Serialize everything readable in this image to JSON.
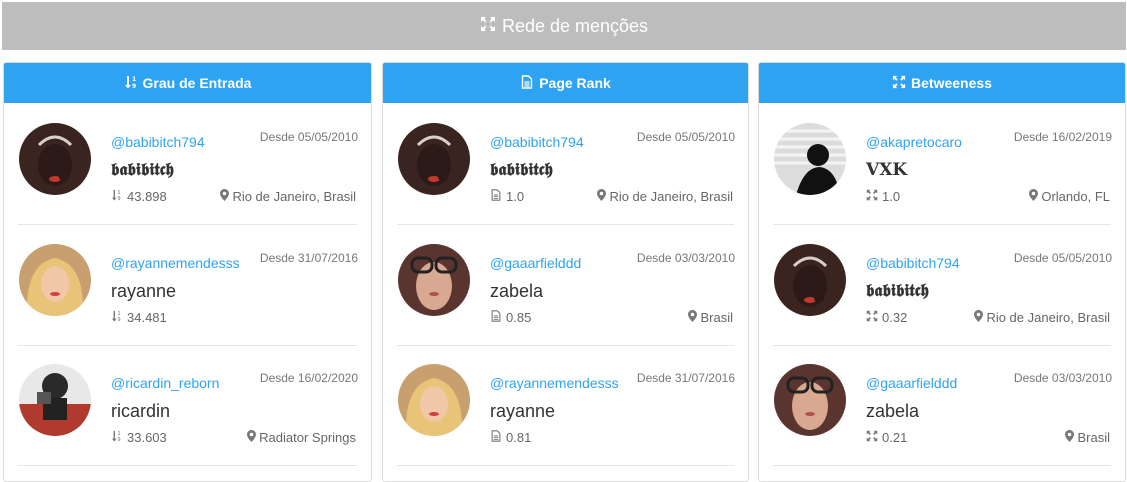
{
  "header": {
    "title": "Rede de menções",
    "icon": "expand-icon"
  },
  "panels": [
    {
      "title": "Grau de Entrada",
      "icon": "sort-numeric-icon",
      "users": [
        {
          "handle": "@babibitch794",
          "since": "Desde 05/05/2010",
          "name": "𝖇𝖆𝖇𝖎𝖇𝖎𝖙𝖈𝖍",
          "metric": "43.898",
          "location": "Rio de Janeiro, Brasil",
          "avatar": "dark"
        },
        {
          "handle": "@rayannemendesss",
          "since": "Desde 31/07/2016",
          "name": "rayanne",
          "metric": "34.481",
          "location": "",
          "avatar": "blonde"
        },
        {
          "handle": "@ricardin_reborn",
          "since": "Desde 16/02/2020",
          "name": "ricardin",
          "metric": "33.603",
          "location": "Radiator Springs",
          "avatar": "mirror"
        }
      ]
    },
    {
      "title": "Page Rank",
      "icon": "file-icon",
      "users": [
        {
          "handle": "@babibitch794",
          "since": "Desde 05/05/2010",
          "name": "𝖇𝖆𝖇𝖎𝖇𝖎𝖙𝖈𝖍",
          "metric": "1.0",
          "location": "Rio de Janeiro, Brasil",
          "avatar": "dark"
        },
        {
          "handle": "@gaaarfielddd",
          "since": "Desde 03/03/2010",
          "name": "zabela",
          "metric": "0.85",
          "location": "Brasil",
          "avatar": "glasses"
        },
        {
          "handle": "@rayannemendesss",
          "since": "Desde 31/07/2016",
          "name": "rayanne",
          "metric": "0.81",
          "location": "",
          "avatar": "blonde"
        }
      ]
    },
    {
      "title": "Betweeness",
      "icon": "expand-icon",
      "users": [
        {
          "handle": "@akapretocaro",
          "since": "Desde 16/02/2019",
          "name": "𝐕𝐗𝐊",
          "metric": "1.0",
          "location": "Orlando, FL",
          "avatar": "silhouette"
        },
        {
          "handle": "@babibitch794",
          "since": "Desde 05/05/2010",
          "name": "𝖇𝖆𝖇𝖎𝖇𝖎𝖙𝖈𝖍",
          "metric": "0.32",
          "location": "Rio de Janeiro, Brasil",
          "avatar": "dark"
        },
        {
          "handle": "@gaaarfielddd",
          "since": "Desde 03/03/2010",
          "name": "zabela",
          "metric": "0.21",
          "location": "Brasil",
          "avatar": "glasses"
        }
      ]
    }
  ]
}
